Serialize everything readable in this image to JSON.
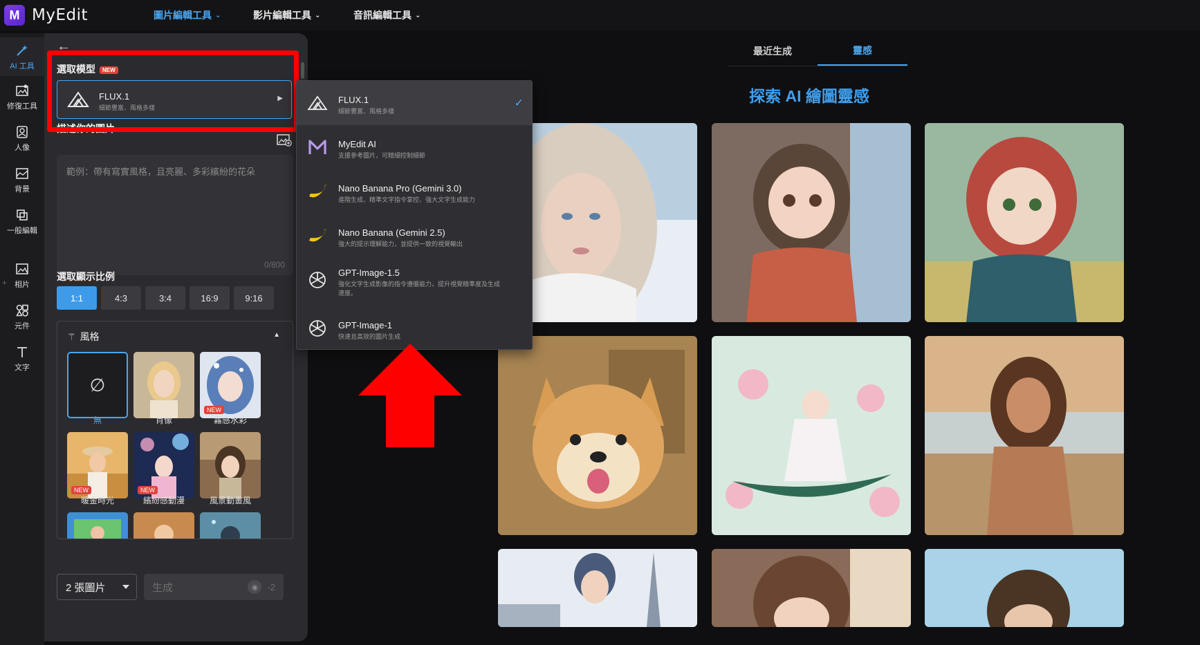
{
  "app": {
    "name": "MyEdit",
    "logo_letter": "M"
  },
  "topnav": [
    {
      "label": "圖片編輯工具",
      "active": true
    },
    {
      "label": "影片編輯工具",
      "active": false
    },
    {
      "label": "音訊編輯工具",
      "active": false
    }
  ],
  "rail": [
    {
      "label": "AI 工具",
      "icon": "magic-wand-icon",
      "active": true
    },
    {
      "label": "修復工具",
      "icon": "image-repair-icon",
      "active": false
    },
    {
      "label": "人像",
      "icon": "portrait-icon",
      "active": false
    },
    {
      "label": "背景",
      "icon": "background-icon",
      "active": false
    },
    {
      "label": "一般編輯",
      "icon": "crop-edit-icon",
      "active": false
    },
    {
      "label": "相片",
      "icon": "photo-icon",
      "active": false
    },
    {
      "label": "元件",
      "icon": "shapes-icon",
      "active": false
    },
    {
      "label": "文字",
      "icon": "text-icon",
      "active": false
    }
  ],
  "rail_plus": "+",
  "panel": {
    "model_title": "選取模型",
    "new_badge": "NEW",
    "selected_model": {
      "name": "FLUX.1",
      "desc": "細節豐富、風格多樣"
    },
    "describe_title": "描述你的圖片",
    "prompt_placeholder": "範例：帶有寫實風格，且亮麗、多彩繽紛的花朵",
    "prompt_counter": "0/800",
    "ratio_title": "選取顯示比例",
    "ratios": [
      "1:1",
      "4:3",
      "3:4",
      "16:9",
      "9:16"
    ],
    "selected_ratio": "1:1",
    "style_title": "風格",
    "styles": [
      {
        "label": "無",
        "selected": true,
        "new": false
      },
      {
        "label": "肖像",
        "selected": false,
        "new": false
      },
      {
        "label": "霧感水彩",
        "selected": false,
        "new": true
      },
      {
        "label": "暖金時光",
        "selected": false,
        "new": true
      },
      {
        "label": "繽紛感動漫",
        "selected": false,
        "new": true
      },
      {
        "label": "風景動畫風",
        "selected": false,
        "new": false
      }
    ],
    "image_count": "2 張圖片",
    "generate_label": "生成",
    "generate_cost": "-2"
  },
  "model_dropdown": [
    {
      "name": "FLUX.1",
      "desc": "細節豐富、風格多樣",
      "icon": "flux-icon",
      "selected": true
    },
    {
      "name": "MyEdit AI",
      "desc": "支援參考圖片，可精細控制細節",
      "icon": "myedit-icon",
      "selected": false
    },
    {
      "name": "Nano Banana Pro (Gemini 3.0)",
      "desc": "進階生成、精準文字指令掌控、強大文字生成能力",
      "icon": "banana-icon",
      "selected": false
    },
    {
      "name": "Nano Banana (Gemini 2.5)",
      "desc": "強大的提示理解能力，並提供一致的視覺輸出",
      "icon": "banana-icon",
      "selected": false
    },
    {
      "name": "GPT-Image-1.5",
      "desc": "強化文字生成影像的指令遵循能力，提升視覺精準度及生成速度。",
      "icon": "openai-icon",
      "selected": false
    },
    {
      "name": "GPT-Image-1",
      "desc": "快速且高效的圖片生成",
      "icon": "openai-icon",
      "selected": false
    }
  ],
  "content": {
    "tabs": [
      {
        "label": "最近生成",
        "active": false
      },
      {
        "label": "靈感",
        "active": true
      }
    ],
    "heading": "探索 AI 繪圖靈感",
    "gallery": [
      "snow-girl-photo",
      "anime-girl-sweater",
      "anime-girl-headscarf",
      "corgi-illustration",
      "lotus-boat-girl",
      "beach-woman-photo",
      "boy-eiffel-tower",
      "girl-window-blossoms",
      "woman-sky-portrait"
    ]
  },
  "colors": {
    "accent": "#4aa6f0",
    "highlight": "#ff0000",
    "badge": "#e0433b"
  }
}
